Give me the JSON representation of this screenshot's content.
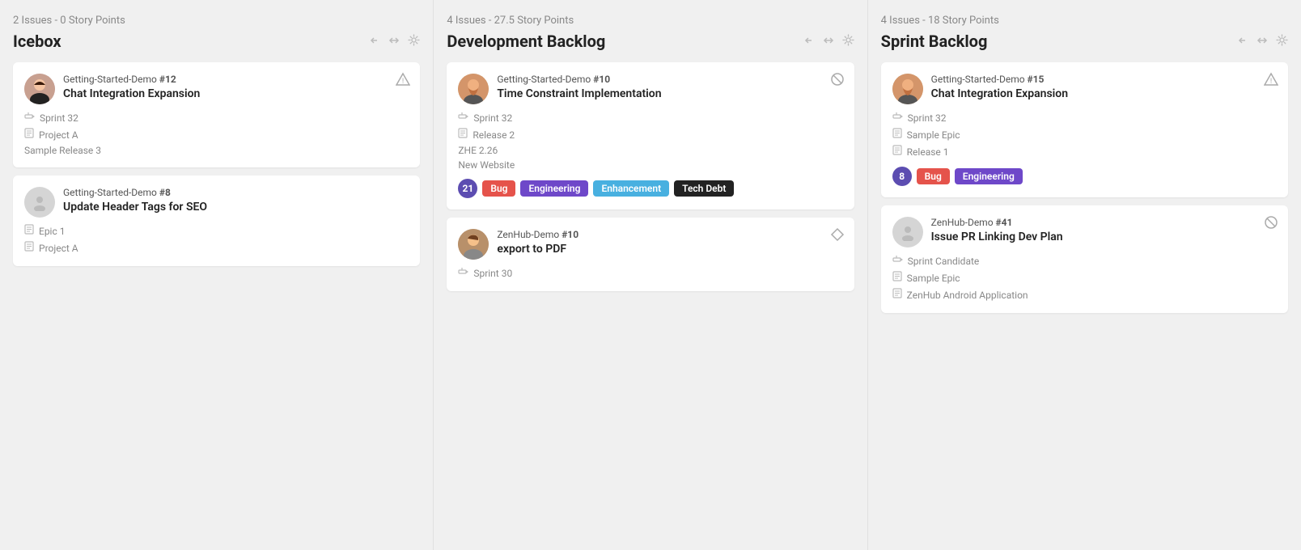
{
  "columns": [
    {
      "id": "icebox",
      "meta": "2 Issues - 0 Story Points",
      "title": "Icebox",
      "cards": [
        {
          "id": "card-12",
          "project": "Getting-Started-Demo",
          "issue_num": "#12",
          "name": "Chat Integration Expansion",
          "status_icon": "warning",
          "avatar_type": "person_female",
          "meta": [
            {
              "icon": "signpost",
              "text": "Sprint 32"
            },
            {
              "icon": "doc",
              "text": "Project A"
            },
            {
              "icon": null,
              "text": "Sample Release 3"
            }
          ],
          "labels": []
        },
        {
          "id": "card-8",
          "project": "Getting-Started-Demo",
          "issue_num": "#8",
          "name": "Update Header Tags for SEO",
          "status_icon": null,
          "avatar_type": "placeholder",
          "meta": [
            {
              "icon": "doc",
              "text": "Epic 1"
            },
            {
              "icon": "doc",
              "text": "Project A"
            }
          ],
          "labels": []
        }
      ]
    },
    {
      "id": "dev-backlog",
      "meta": "4 Issues - 27.5 Story Points",
      "title": "Development Backlog",
      "cards": [
        {
          "id": "card-10",
          "project": "Getting-Started-Demo",
          "issue_num": "#10",
          "name": "Time Constraint Implementation",
          "status_icon": "circle-slash",
          "avatar_type": "person_male_beard",
          "meta": [
            {
              "icon": "signpost",
              "text": "Sprint 32"
            },
            {
              "icon": "doc",
              "text": "Release 2"
            },
            {
              "icon": null,
              "text": "ZHE 2.26"
            },
            {
              "icon": null,
              "text": "New Website"
            }
          ],
          "labels": [
            {
              "type": "count",
              "value": "21"
            },
            {
              "type": "bug",
              "value": "Bug"
            },
            {
              "type": "engineering",
              "value": "Engineering"
            },
            {
              "type": "enhancement",
              "value": "Enhancement"
            },
            {
              "type": "techdebt",
              "value": "Tech Debt"
            }
          ]
        },
        {
          "id": "card-10b",
          "project": "ZenHub-Demo",
          "issue_num": "#10",
          "name": "export to PDF",
          "status_icon": "diamond",
          "avatar_type": "person_male_young",
          "meta": [
            {
              "icon": "signpost",
              "text": "Sprint 30"
            }
          ],
          "labels": []
        }
      ]
    },
    {
      "id": "sprint-backlog",
      "meta": "4 Issues - 18 Story Points",
      "title": "Sprint Backlog",
      "cards": [
        {
          "id": "card-15",
          "project": "Getting-Started-Demo",
          "issue_num": "#15",
          "name": "Chat Integration Expansion",
          "status_icon": "warning",
          "avatar_type": "person_male_beard",
          "meta": [
            {
              "icon": "signpost",
              "text": "Sprint 32"
            },
            {
              "icon": "doc",
              "text": "Sample Epic"
            },
            {
              "icon": "doc",
              "text": "Release 1"
            }
          ],
          "labels": [
            {
              "type": "count",
              "value": "8"
            },
            {
              "type": "bug",
              "value": "Bug"
            },
            {
              "type": "engineering",
              "value": "Engineering"
            }
          ]
        },
        {
          "id": "card-41",
          "project": "ZenHub-Demo",
          "issue_num": "#41",
          "name": "Issue PR Linking Dev Plan",
          "status_icon": "circle-slash",
          "avatar_type": "placeholder",
          "meta": [
            {
              "icon": "signpost",
              "text": "Sprint Candidate"
            },
            {
              "icon": "doc",
              "text": "Sample Epic"
            },
            {
              "icon": "doc",
              "text": "ZenHub Android Application"
            }
          ],
          "labels": []
        }
      ]
    }
  ],
  "icons": {
    "arrow_left": "←",
    "arrows_expand": "⇄",
    "gear": "⚙",
    "warning": "⚠",
    "circle_slash": "⊘",
    "diamond": "◇",
    "signpost": "⇥",
    "doc": "▤"
  }
}
